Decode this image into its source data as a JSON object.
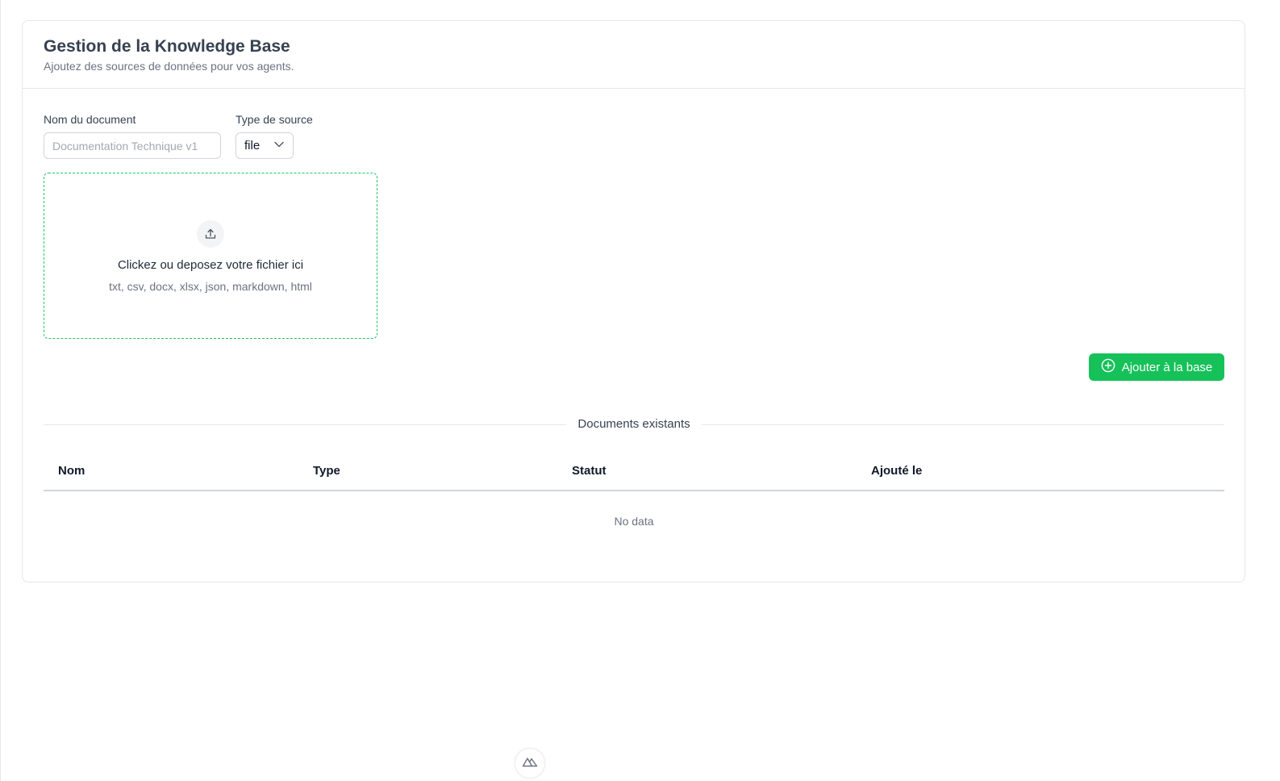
{
  "header": {
    "title": "Gestion de la Knowledge Base",
    "subtitle": "Ajoutez des sources de données pour vos agents."
  },
  "form": {
    "name_label": "Nom du document",
    "name_placeholder": "Documentation Technique v1",
    "name_value": "",
    "type_label": "Type de source",
    "type_value": "file"
  },
  "dropzone": {
    "icon": "upload-icon",
    "main_text": "Clickez ou deposez votre fichier ici",
    "formats": "txt, csv, docx, xlsx, json, markdown, html"
  },
  "actions": {
    "add_label": "Ajouter à la base",
    "add_icon": "plus-circle-icon",
    "accent_color": "#16c15a"
  },
  "documents": {
    "divider_label": "Documents existants",
    "columns": [
      "Nom",
      "Type",
      "Statut",
      "Ajouté le"
    ],
    "rows": [],
    "empty_text": "No data"
  },
  "devtools": {
    "icon": "nuxt-logo-icon"
  }
}
